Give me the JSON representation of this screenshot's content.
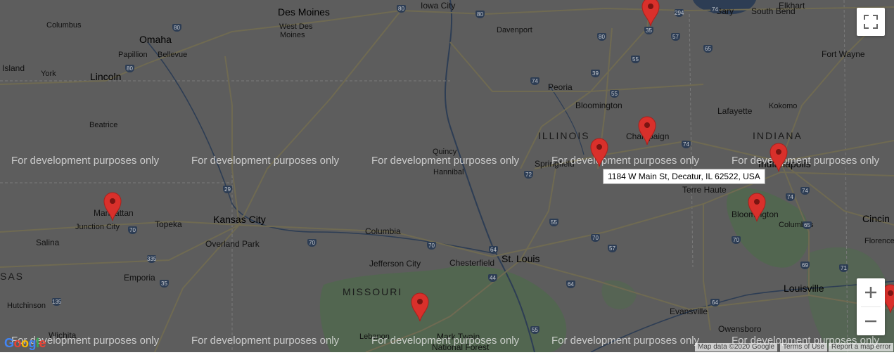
{
  "map": {
    "colors": {
      "background": "#5d5d5d",
      "water": "#2d3d54",
      "forest": "#4f6b4c",
      "road": "#6f6a52",
      "pin": "#d9302b"
    },
    "places": [
      {
        "name": "Des Moines"
      },
      {
        "name": "West Des"
      },
      {
        "name": "Moines"
      },
      {
        "name": "Iowa City"
      },
      {
        "name": "Davenport"
      },
      {
        "name": "Gary"
      },
      {
        "name": "South Bend"
      },
      {
        "name": "Elkhart"
      },
      {
        "name": "Columbus"
      },
      {
        "name": "Omaha"
      },
      {
        "name": "Papillion"
      },
      {
        "name": "Bellevue"
      },
      {
        "name": "Island"
      },
      {
        "name": "York"
      },
      {
        "name": "Lincoln"
      },
      {
        "name": "Fort Wayne"
      },
      {
        "name": "Peoria"
      },
      {
        "name": "Bloomington"
      },
      {
        "name": "Lafayette"
      },
      {
        "name": "Kokomo"
      },
      {
        "name": "Beatrice"
      },
      {
        "name": "Champaign"
      },
      {
        "name": "Quincy"
      },
      {
        "name": "Hannibal"
      },
      {
        "name": "Springfield"
      },
      {
        "name": "Terre Haute"
      },
      {
        "name": "Indianapolis"
      },
      {
        "name": "Manhattan"
      },
      {
        "name": "Junction City"
      },
      {
        "name": "Topeka"
      },
      {
        "name": "Kansas City"
      },
      {
        "name": "Overland Park"
      },
      {
        "name": "Columbia"
      },
      {
        "name": "Bloomington"
      },
      {
        "name": "Columbus"
      },
      {
        "name": "Cincin"
      },
      {
        "name": "Salina"
      },
      {
        "name": "Florence"
      },
      {
        "name": "St. Louis"
      },
      {
        "name": "Chesterfield"
      },
      {
        "name": "Jefferson City"
      },
      {
        "name": "Emporia"
      },
      {
        "name": "Louisville"
      },
      {
        "name": "Hutchinson"
      },
      {
        "name": "Evansville"
      },
      {
        "name": "Owensboro"
      },
      {
        "name": "Wichita"
      },
      {
        "name": "Lebanon"
      },
      {
        "name": "Mark Twain"
      },
      {
        "name": "National Forest"
      }
    ],
    "states": [
      {
        "name": "ILLINOIS"
      },
      {
        "name": "INDIANA"
      },
      {
        "name": "MISSOURI"
      },
      {
        "name": "SAS"
      }
    ],
    "shields": [
      "80",
      "80",
      "80",
      "35",
      "74",
      "294",
      "80",
      "65",
      "80",
      "39",
      "55",
      "57",
      "74",
      "55",
      "74",
      "29",
      "72",
      "74",
      "55",
      "70",
      "57",
      "70",
      "64",
      "70",
      "69",
      "65",
      "71",
      "335",
      "35",
      "135",
      "64",
      "55",
      "44",
      "70",
      "64",
      "74",
      "70"
    ],
    "dev_watermark": "For development purposes only",
    "pins": [
      {
        "location": "Kankakee area"
      },
      {
        "location": "Champaign"
      },
      {
        "location": "Decatur"
      },
      {
        "location": "Indianapolis"
      },
      {
        "location": "Bloomington, IN"
      },
      {
        "location": "Manhattan"
      },
      {
        "location": "Lebanon"
      },
      {
        "location": "Cincinnati edge"
      }
    ],
    "tooltip": "1184 W Main St, Decatur, IL 62522, USA"
  },
  "controls": {
    "fullscreen_icon": "fullscreen-icon",
    "zoom_in_icon": "plus-icon",
    "zoom_out_icon": "minus-icon"
  },
  "attribution": {
    "logo": "Google",
    "map_data": "Map data ©2020 Google",
    "terms": "Terms of Use",
    "report": "Report a map error"
  }
}
